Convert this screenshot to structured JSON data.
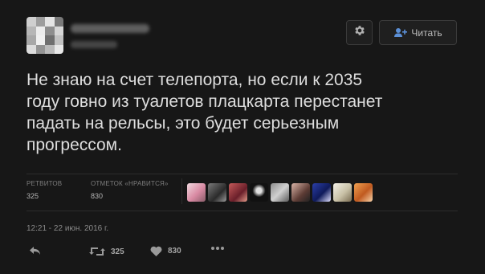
{
  "tweet": {
    "text": "Не знаю на счет телепорта, но если к 2035\nгоду говно из туалетов плацкарта перестанет\nпадать на рельсы, это будет серьезным\nпрогрессом.",
    "timestamp": "12:21 - 22 июн. 2016 г."
  },
  "header": {
    "follow_label": "Читать",
    "settings_icon": "gear-icon",
    "follow_icon": "add-user-icon"
  },
  "stats": {
    "retweets_label": "РЕТВИТОВ",
    "retweets_value": "325",
    "likes_label": "ОТМЕТОК «НРАВИТСЯ»",
    "likes_value": "830"
  },
  "actions": {
    "reply_icon": "reply-icon",
    "retweet_icon": "retweet-icon",
    "retweet_count": "325",
    "like_icon": "heart-icon",
    "like_count": "830",
    "more_icon": "more-icon"
  },
  "colors": {
    "background": "#171717",
    "text": "#dedede",
    "muted": "#7d7d7d",
    "accent": "#5b8fd6"
  }
}
